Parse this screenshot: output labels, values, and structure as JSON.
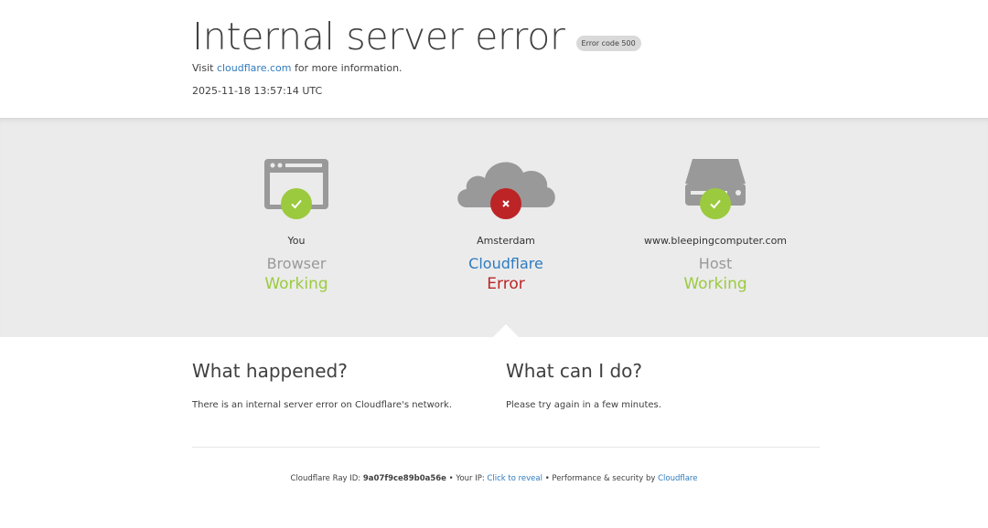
{
  "header": {
    "title": "Internal server error",
    "error_badge": "Error code 500",
    "visit_prefix": "Visit",
    "visit_link": "cloudflare.com",
    "visit_suffix": "for more information.",
    "timestamp": "2025-11-18 13:57:14 UTC"
  },
  "status": {
    "browser": {
      "location": "You",
      "role": "Browser",
      "status": "Working",
      "icon": "browser-icon",
      "indicator": "check"
    },
    "cloudflare": {
      "location": "Amsterdam",
      "role": "Cloudflare",
      "status": "Error",
      "icon": "cloud-icon",
      "indicator": "cross"
    },
    "host": {
      "location": "www.bleepingcomputer.com",
      "role": "Host",
      "status": "Working",
      "icon": "server-icon",
      "indicator": "check"
    }
  },
  "sections": {
    "what_happened": {
      "heading": "What happened?",
      "text": "There is an internal server error on Cloudflare's network."
    },
    "what_can_i_do": {
      "heading": "What can I do?",
      "text": "Please try again in a few minutes."
    }
  },
  "footer": {
    "ray_label": "Cloudflare Ray ID:",
    "ray_id": "9a07f9ce89b0a56e",
    "separator": "•",
    "ip_label": "Your IP:",
    "reveal_link": "Click to reveal",
    "performance_label": "Performance & security by",
    "cloudflare_link": "Cloudflare"
  },
  "colors": {
    "working": "#9bca3e",
    "error": "#bd2426",
    "link": "#2f7bbf",
    "icon_gray": "#999999",
    "band_bg": "#ebebeb"
  }
}
